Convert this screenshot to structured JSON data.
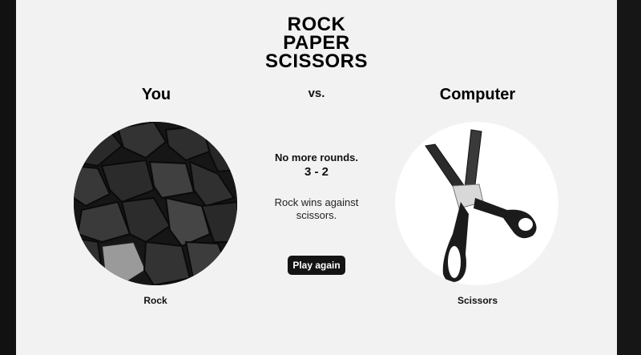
{
  "title_lines": [
    "ROCK",
    "PAPER",
    "SCISSORS"
  ],
  "players": {
    "you_label": "You",
    "vs_label": "vs.",
    "computer_label": "Computer"
  },
  "choices": {
    "you": {
      "label": "Rock",
      "icon": "rock-image"
    },
    "computer": {
      "label": "Scissors",
      "icon": "scissors-image"
    }
  },
  "status": {
    "message": "No more rounds.",
    "score": "3 - 2",
    "result": "Rock wins against scissors."
  },
  "buttons": {
    "play_again": "Play again"
  }
}
